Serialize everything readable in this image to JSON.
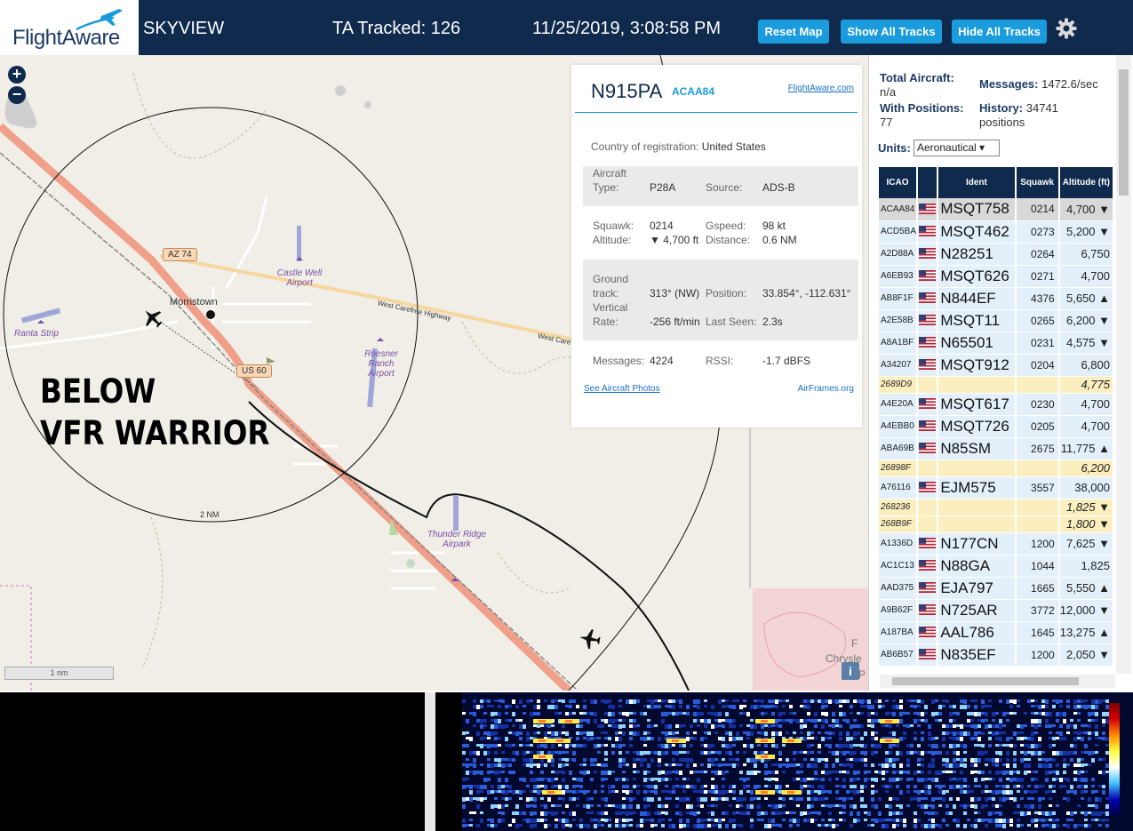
{
  "header": {
    "logo_text": "FlightAware",
    "site_name": "SKYVIEW",
    "tracked_label": "TA Tracked: 126",
    "datetime": "11/25/2019, 3:08:58 PM",
    "buttons": [
      "Reset Map",
      "Show All Tracks",
      "Hide All Tracks"
    ],
    "settings_icon": "gear-icon"
  },
  "map": {
    "zoom_in": "+",
    "zoom_out": "−",
    "labels": {
      "town": "Morristown",
      "highway_west_carefree": "West Carefree Highway",
      "highway_west_care": "West Care",
      "az74": "AZ 74",
      "us60": "US 60",
      "ranta": "Ranta Strip",
      "castle_well": "Castle Well Airport",
      "roesner": "Roesner Ranch Airport",
      "thunder": "Thunder Ridge Airpark",
      "range_ring": "2 NM",
      "scale": "1 nm",
      "chrysler": "Chrysle",
      "f_letter": "F",
      "p_letter": "P"
    },
    "annotation_line1": "BELOW",
    "annotation_line2": "VFR WARRIOR",
    "info_button": "i"
  },
  "popup": {
    "registration": "N915PA",
    "hex": "ACAA84",
    "link": "FlightAware.com",
    "country_label": "Country of registration:",
    "country": "United States",
    "aircraft_type_label1": "Aircraft",
    "aircraft_type_label2": "Type:",
    "aircraft_type": "P28A",
    "source_label": "Source:",
    "source": "ADS-B",
    "squawk_label": "Squawk:",
    "squawk": "0214",
    "gspeed_label": "Gspeed:",
    "gspeed": "98 kt",
    "altitude_label": "Altitude:",
    "altitude": "▼ 4,700 ft",
    "distance_label": "Distance:",
    "distance": "0.6 NM",
    "ground_label1": "Ground",
    "ground_label2": "track:",
    "ground_track": "313° (NW)",
    "position_label": "Position:",
    "position": "33.854°, -112.631°",
    "vrate_label1": "Vertical",
    "vrate_label2": "Rate:",
    "vrate": "-256 ft/min",
    "lastseen_label": "Last Seen:",
    "lastseen": "2.3s",
    "messages_label": "Messages:",
    "messages": "4224",
    "rssi_label": "RSSI:",
    "rssi": "-1.7 dBFS",
    "photos_link": "See Aircraft Photos",
    "airframes_link": "AirFrames.org"
  },
  "panel": {
    "total_label": "Total Aircraft:",
    "total_value": "n/a",
    "messages_label": "Messages:",
    "messages_value": "1472.6/sec",
    "positions_label": "With Positions:",
    "positions_value": "77",
    "history_label": "History:",
    "history_value": "34741",
    "history_unit": "positions",
    "units_label": "Units:",
    "units_value": "Aeronautical ▾",
    "columns": [
      "ICAO",
      "",
      "Ident",
      "Squawk",
      "Altitude (ft)"
    ],
    "rows": [
      {
        "icao": "ACAA84",
        "ident": "MSQT758",
        "squawk": "0214",
        "alt": "4,700 ▼",
        "flag": true,
        "kind": "sel"
      },
      {
        "icao": "ACD5BA",
        "ident": "MSQT462",
        "squawk": "0273",
        "alt": "5,200 ▼",
        "flag": true,
        "kind": "norm"
      },
      {
        "icao": "A2D88A",
        "ident": "N28251",
        "squawk": "0264",
        "alt": "6,750",
        "flag": true,
        "kind": "norm"
      },
      {
        "icao": "A6EB93",
        "ident": "MSQT626",
        "squawk": "0271",
        "alt": "4,700",
        "flag": true,
        "kind": "norm"
      },
      {
        "icao": "AB8F1F",
        "ident": "N844EF",
        "squawk": "4376",
        "alt": "5,650 ▲",
        "flag": true,
        "kind": "norm"
      },
      {
        "icao": "A2E58B",
        "ident": "MSQT11",
        "squawk": "0265",
        "alt": "6,200 ▼",
        "flag": true,
        "kind": "norm"
      },
      {
        "icao": "A8A1BF",
        "ident": "N65501",
        "squawk": "0231",
        "alt": "4,575 ▼",
        "flag": true,
        "kind": "norm"
      },
      {
        "icao": "A34207",
        "ident": "MSQT912",
        "squawk": "0204",
        "alt": "6,800",
        "flag": true,
        "kind": "norm"
      },
      {
        "icao": "2689D9",
        "ident": "",
        "squawk": "",
        "alt": "4,775",
        "flag": false,
        "kind": "mlat"
      },
      {
        "icao": "A4E20A",
        "ident": "MSQT617",
        "squawk": "0230",
        "alt": "4,700",
        "flag": true,
        "kind": "norm"
      },
      {
        "icao": "A4EBB0",
        "ident": "MSQT726",
        "squawk": "0205",
        "alt": "4,700",
        "flag": true,
        "kind": "norm"
      },
      {
        "icao": "ABA69B",
        "ident": "N85SM",
        "squawk": "2675",
        "alt": "11,775 ▲",
        "flag": true,
        "kind": "norm"
      },
      {
        "icao": "26898F",
        "ident": "",
        "squawk": "",
        "alt": "6,200",
        "flag": false,
        "kind": "mlat"
      },
      {
        "icao": "A76116",
        "ident": "EJM575",
        "squawk": "3557",
        "alt": "38,000",
        "flag": true,
        "kind": "norm"
      },
      {
        "icao": "268236",
        "ident": "",
        "squawk": "",
        "alt": "1,825 ▼",
        "flag": false,
        "kind": "mlat"
      },
      {
        "icao": "268B9F",
        "ident": "",
        "squawk": "",
        "alt": "1,800 ▼",
        "flag": false,
        "kind": "mlat"
      },
      {
        "icao": "A1336D",
        "ident": "N177CN",
        "squawk": "1200",
        "alt": "7,625 ▼",
        "flag": true,
        "kind": "norm"
      },
      {
        "icao": "AC1C13",
        "ident": "N88GA",
        "squawk": "1044",
        "alt": "1,825",
        "flag": true,
        "kind": "norm"
      },
      {
        "icao": "AAD375",
        "ident": "EJA797",
        "squawk": "1665",
        "alt": "5,550 ▲",
        "flag": true,
        "kind": "norm"
      },
      {
        "icao": "A9B62F",
        "ident": "N725AR",
        "squawk": "3772",
        "alt": "12,000 ▼",
        "flag": true,
        "kind": "norm"
      },
      {
        "icao": "A187BA",
        "ident": "AAL786",
        "squawk": "1645",
        "alt": "13,275 ▲",
        "flag": true,
        "kind": "norm"
      },
      {
        "icao": "AB6B57",
        "ident": "N835EF",
        "squawk": "1200",
        "alt": "2,050 ▼",
        "flag": true,
        "kind": "norm"
      }
    ]
  },
  "colors": {
    "header_bg": "#0f2a4d",
    "button_bg": "#1a9bdc",
    "row_bg": "#e3f0fa",
    "mlat_row_bg": "#fbefbf",
    "selected_row_bg": "#d8d8d8",
    "map_bg": "#f0eee6"
  }
}
